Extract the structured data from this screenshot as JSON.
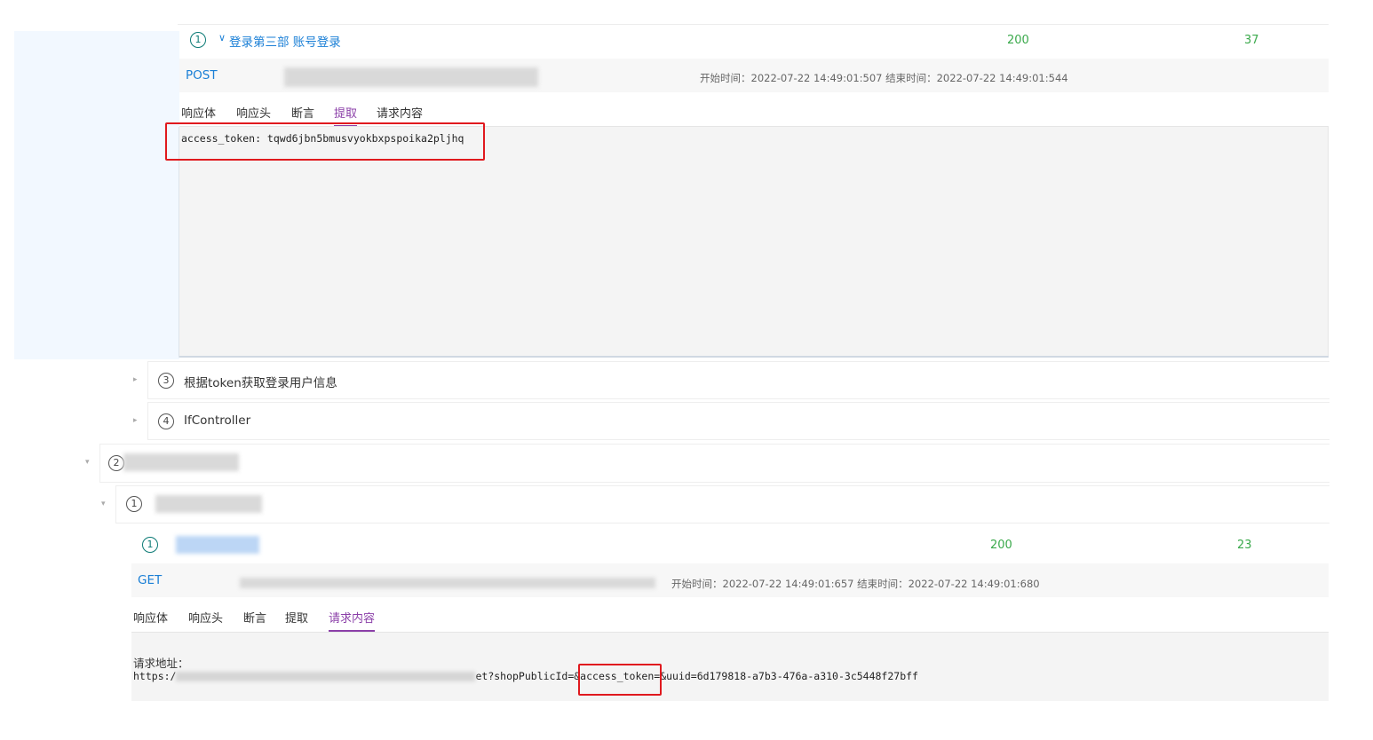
{
  "step1": {
    "number": "1",
    "title": "登录第三部 账号登录",
    "status": "200",
    "duration": "37",
    "method": "POST",
    "time_info": "开始时间：2022-07-22 14:49:01:507 结束时间：2022-07-22 14:49:01:544",
    "tabs": [
      "响应体",
      "响应头",
      "断言",
      "提取",
      "请求内容"
    ],
    "active_tab": "提取",
    "extract_text": "access_token: tqwd6jbn5bmusvyokbxpspoika2pljhq"
  },
  "step3": {
    "number": "3",
    "title": "根据token获取登录用户信息"
  },
  "step4": {
    "number": "4",
    "title": "IfController"
  },
  "group2": {
    "number": "2"
  },
  "group2_sub": {
    "number": "1"
  },
  "step_b": {
    "number": "1",
    "status": "200",
    "duration": "23",
    "method": "GET",
    "time_info": "开始时间：2022-07-22 14:49:01:657 结束时间：2022-07-22 14:49:01:680",
    "tabs": [
      "响应体",
      "响应头",
      "断言",
      "提取",
      "请求内容"
    ],
    "active_tab": "请求内容",
    "request_label": "请求地址：",
    "url_prefix": "https:/",
    "url_mid": "et?shopPublicId=",
    "url_token": "&access_token=",
    "url_suffix": "&uuid=6d179818-a7b3-476a-a310-3c5448f27bff"
  },
  "colors": {
    "accent_blue": "#1a7fd6",
    "active_tab": "#8b3fa8",
    "status_green": "#3aa94b",
    "highlight_red": "#e0191e"
  }
}
